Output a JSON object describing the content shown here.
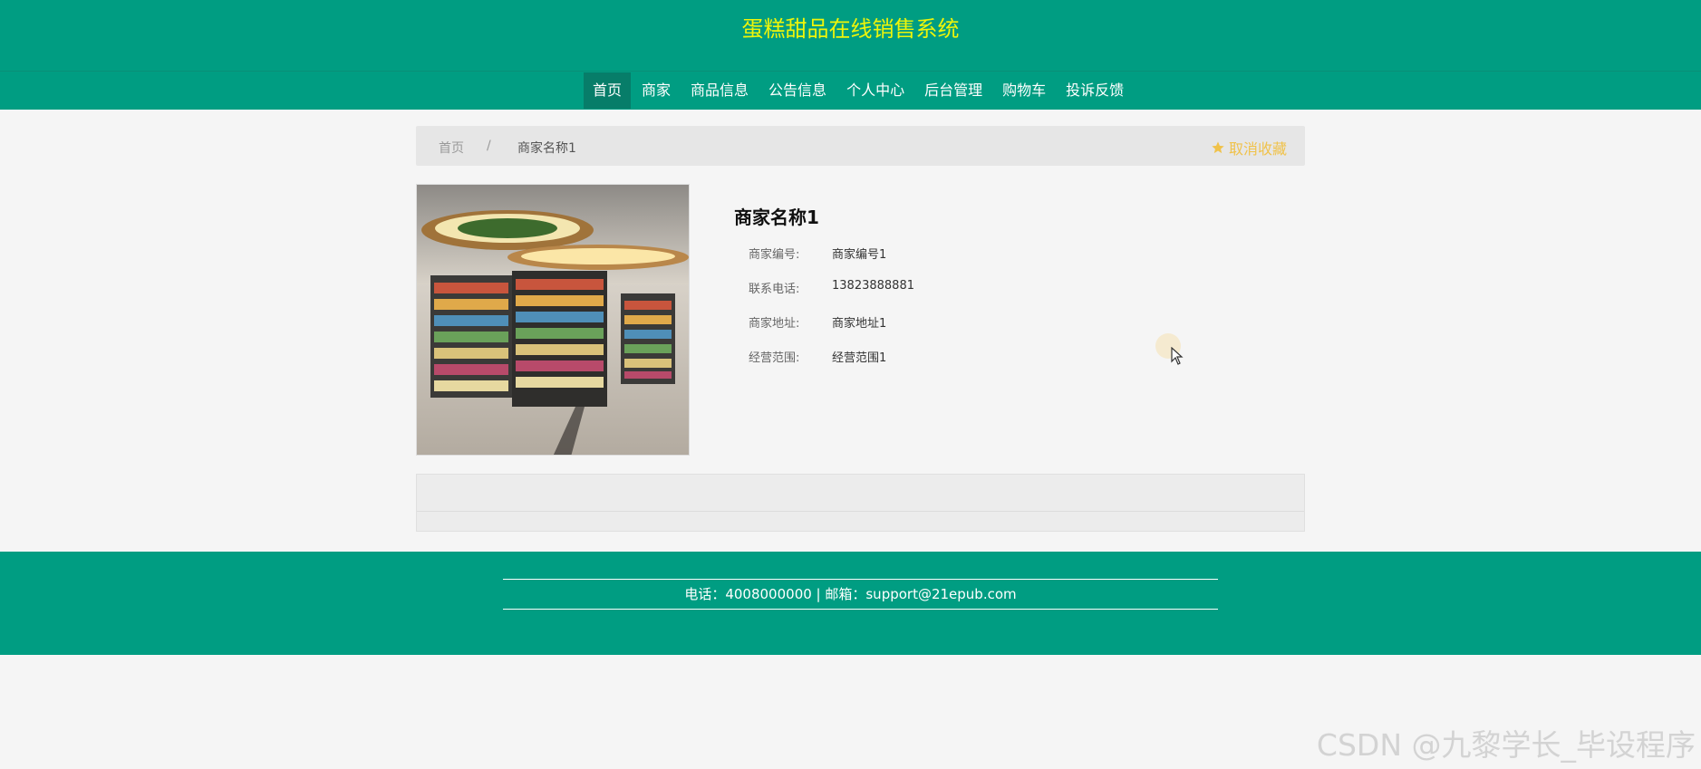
{
  "header": {
    "title": "蛋糕甜品在线销售系统"
  },
  "nav": {
    "items": [
      {
        "label": "首页"
      },
      {
        "label": "商家"
      },
      {
        "label": "商品信息"
      },
      {
        "label": "公告信息"
      },
      {
        "label": "个人中心"
      },
      {
        "label": "后台管理"
      },
      {
        "label": "购物车"
      },
      {
        "label": "投诉反馈"
      }
    ]
  },
  "breadcrumb": {
    "home": "首页",
    "separator": "/",
    "current": "商家名称1"
  },
  "favorite": {
    "label": "取消收藏",
    "icon": "star-icon",
    "color": "#f0c24a"
  },
  "shop": {
    "name": "商家名称1",
    "fields": [
      {
        "label": "商家编号:",
        "value": "商家编号1"
      },
      {
        "label": "联系电话:",
        "value": "13823888881"
      },
      {
        "label": "商家地址:",
        "value": "商家地址1"
      },
      {
        "label": "经营范围:",
        "value": "经营范围1"
      }
    ]
  },
  "footer": {
    "text": "电话：4008000000 | 邮箱：support@21epub.com"
  },
  "watermark": "CSDN @九黎学长_毕设程序",
  "colors": {
    "brand": "#009d82",
    "title": "#eef50a",
    "nav_active": "#077d69"
  }
}
